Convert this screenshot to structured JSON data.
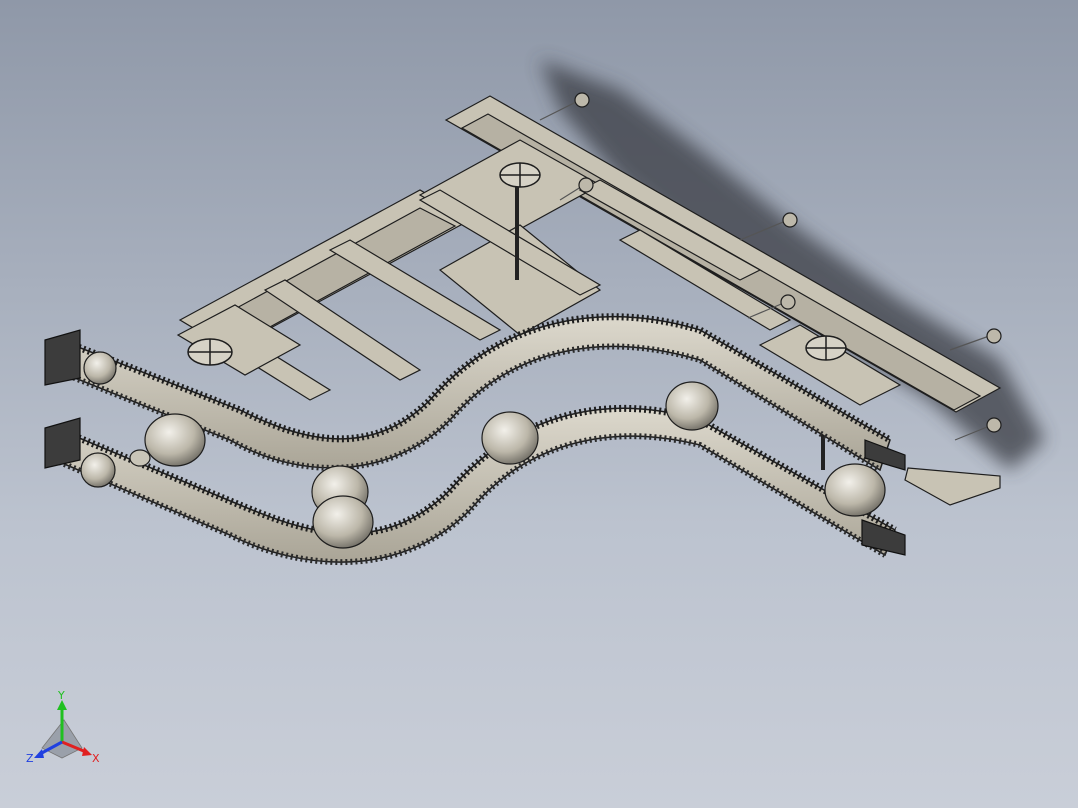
{
  "viewport": {
    "background_top": "#8f98a8",
    "background_bottom": "#c9ced8"
  },
  "model": {
    "description_icon": "conveyor-assembly-3d-model",
    "part_color": "#c8c3b4",
    "edge_color": "#1e1e1e",
    "shadow_color": "#3a3d45"
  },
  "triad": {
    "x_label": "X",
    "y_label": "Y",
    "z_label": "Z",
    "x_color": "#e02020",
    "y_color": "#20c020",
    "z_color": "#2040e0"
  }
}
